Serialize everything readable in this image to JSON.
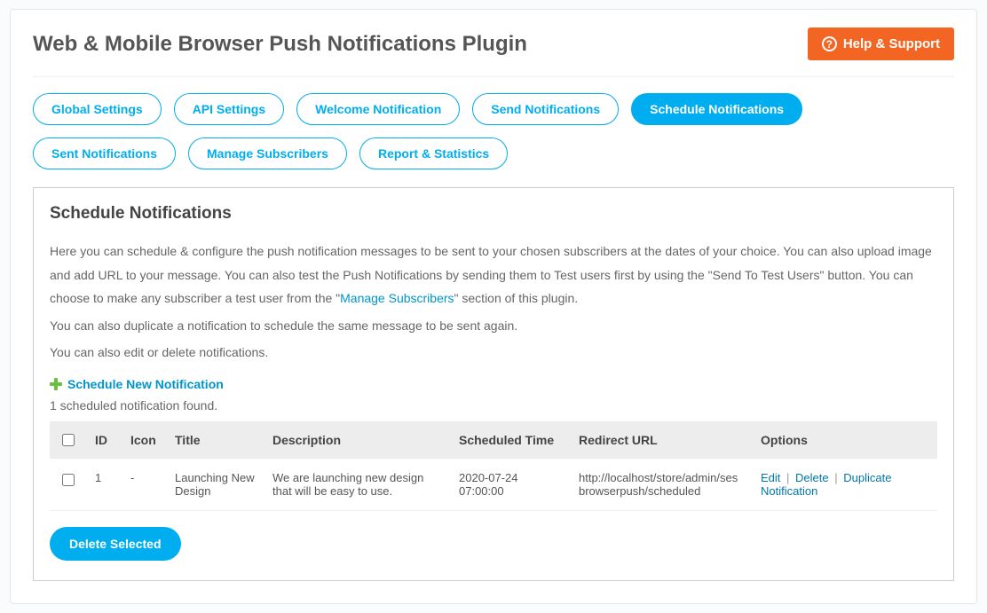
{
  "header": {
    "title": "Web & Mobile Browser Push Notifications Plugin",
    "help_label": "Help & Support"
  },
  "tabs": [
    {
      "label": "Global Settings",
      "active": false
    },
    {
      "label": "API Settings",
      "active": false
    },
    {
      "label": "Welcome Notification",
      "active": false
    },
    {
      "label": "Send Notifications",
      "active": false
    },
    {
      "label": "Schedule Notifications",
      "active": true
    },
    {
      "label": "Sent Notifications",
      "active": false
    },
    {
      "label": "Manage Subscribers",
      "active": false
    },
    {
      "label": "Report & Statistics",
      "active": false
    }
  ],
  "section": {
    "heading": "Schedule Notifications",
    "p1a": "Here you can schedule & configure the push notification messages to be sent to your chosen subscribers at the dates of your choice. You can also upload image and add URL to your message. You can also test the Push Notifications by sending them to Test users first by using the \"Send To Test Users\" button. You can choose to make any subscriber a test user from the \"",
    "p1_link": "Manage Subscribers",
    "p1b": "\" section of this plugin.",
    "p2": "You can also duplicate a notification to schedule the same message to be sent again.",
    "p3": "You can also edit or delete notifications.",
    "add_new_label": "Schedule New Notification",
    "found_text": "1 scheduled notification found."
  },
  "table": {
    "headers": {
      "id": "ID",
      "icon": "Icon",
      "title": "Title",
      "description": "Description",
      "scheduled_time": "Scheduled Time",
      "redirect_url": "Redirect URL",
      "options": "Options"
    },
    "rows": [
      {
        "id": "1",
        "icon": "-",
        "title": "Launching New Design",
        "description": "We are launching new design that will be easy to use.",
        "scheduled_time": "2020-07-24 07:00:00",
        "redirect_url": "http://localhost/store/admin/sesbrowserpush/scheduled",
        "options": {
          "edit": "Edit",
          "delete": "Delete",
          "duplicate": "Duplicate Notification"
        }
      }
    ]
  },
  "buttons": {
    "delete_selected": "Delete Selected"
  }
}
